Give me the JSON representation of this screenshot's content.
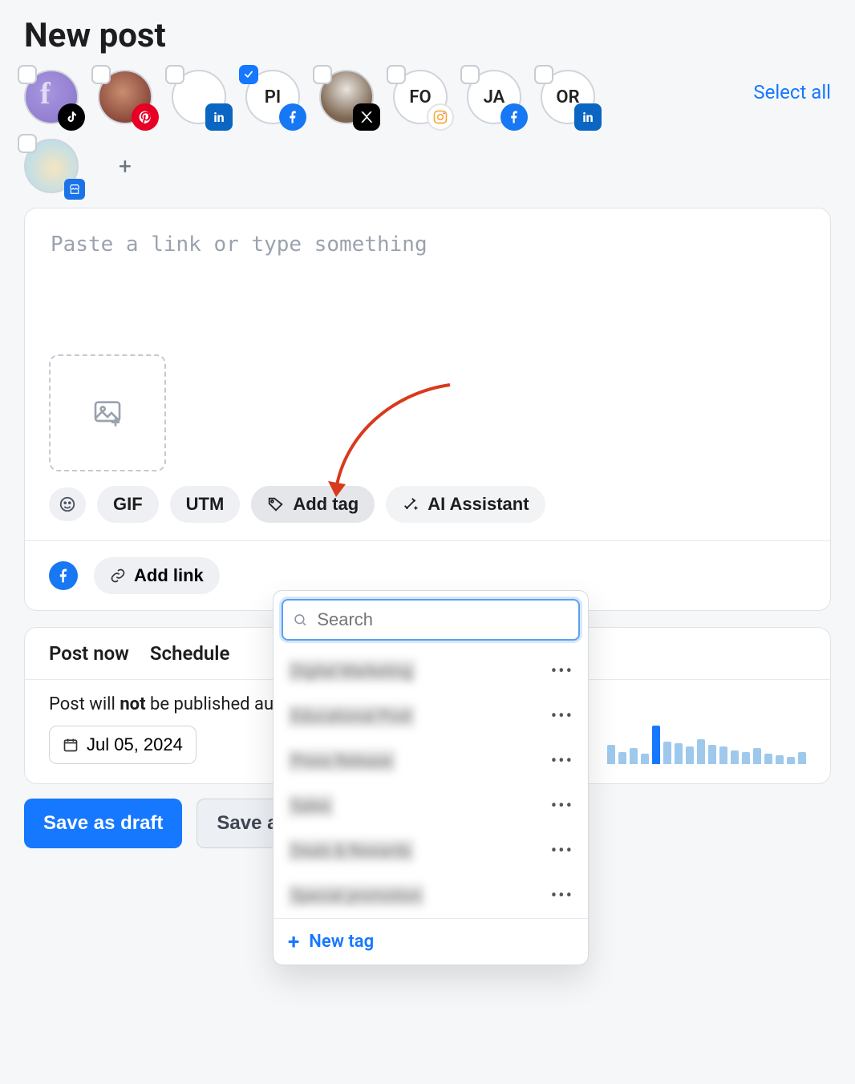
{
  "page_title": "New post",
  "select_all": "Select all",
  "channels": [
    {
      "label": "",
      "checked": false,
      "badge": "tiktok",
      "avatar": "purple",
      "f_letter": true
    },
    {
      "label": "",
      "checked": false,
      "badge": "pinterest",
      "avatar": "photo1"
    },
    {
      "label": "",
      "checked": false,
      "badge": "linkedin",
      "avatar": "blank"
    },
    {
      "label": "PI",
      "checked": true,
      "badge": "facebook",
      "avatar": "blank"
    },
    {
      "label": "",
      "checked": false,
      "badge": "x",
      "avatar": "photo2"
    },
    {
      "label": "FO",
      "checked": false,
      "badge": "instagram",
      "avatar": "blank"
    },
    {
      "label": "JA",
      "checked": false,
      "badge": "facebook",
      "avatar": "blank"
    },
    {
      "label": "OR",
      "checked": false,
      "badge": "linkedin",
      "avatar": "blank"
    },
    {
      "label": "",
      "checked": false,
      "badge": "google",
      "avatar": "ball"
    }
  ],
  "composer": {
    "placeholder": "Paste a link or type something"
  },
  "actions": {
    "gif": "GIF",
    "utm": "UTM",
    "add_tag": "Add tag",
    "ai_assistant": "AI Assistant",
    "add_link": "Add link"
  },
  "tag_popover": {
    "search_placeholder": "Search",
    "items": [
      "Digital Marketing",
      "Educational Post",
      "Press Release",
      "Sales",
      "Deals & Rewards",
      "Special promotion"
    ],
    "new_tag": "New tag"
  },
  "schedule": {
    "tabs": {
      "now": "Post now",
      "schedule": "Schedule"
    },
    "message_pre": "Post will ",
    "message_not": "not",
    "message_post": " be published automatically.",
    "date": "Jul 05, 2024",
    "bars": [
      22,
      14,
      18,
      12,
      44,
      26,
      24,
      20,
      28,
      22,
      20,
      16,
      14,
      18,
      12,
      10,
      8,
      14
    ]
  },
  "buttons": {
    "primary": "Save as draft",
    "secondary": "Save as draft & create another"
  },
  "colors": {
    "primary": "#1677ff",
    "arrow": "#d83a1c"
  }
}
